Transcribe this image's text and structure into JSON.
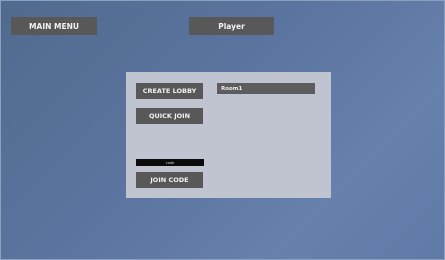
{
  "header": {
    "main_menu_label": "MAIN MENU",
    "player_label": "Player"
  },
  "lobby_panel": {
    "create_lobby_label": "CREATE LOBBY",
    "quick_join_label": "QUICK JOIN",
    "code_placeholder": "code",
    "join_code_label": "JOIN CODE",
    "lobbies": [
      {
        "name": "Room1"
      }
    ]
  },
  "colors": {
    "background": "#5b75a0",
    "panel": "#bfc4d0",
    "button": "#585858",
    "input": "#0c0c0c"
  }
}
